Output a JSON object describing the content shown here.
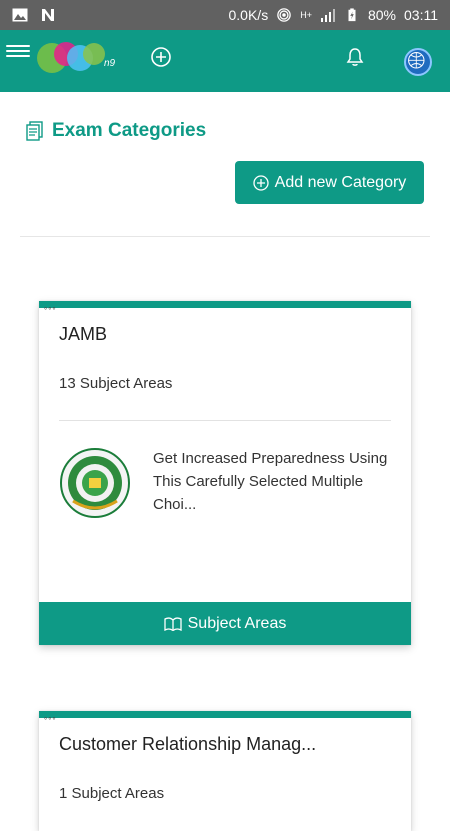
{
  "status_bar": {
    "speed": "0.0K/s",
    "network": "H+",
    "battery": "80%",
    "time": "03:11"
  },
  "header": {
    "logo_text": "n9",
    "icons": [
      "menu-icon",
      "add-circle-icon",
      "bell-icon",
      "avatar"
    ]
  },
  "page": {
    "title": "Exam Categories",
    "add_button_label": "Add new Category"
  },
  "cards": [
    {
      "title": "JAMB",
      "subject_count": "13 Subject Areas",
      "description": "Get Increased Preparedness Using This Carefully Selected Multiple Choi...",
      "footer_label": "Subject Areas"
    },
    {
      "title": "Customer Relationship Manag...",
      "subject_count": "1 Subject Areas"
    }
  ],
  "colors": {
    "primary": "#0e9a86",
    "statusbar": "#616161"
  }
}
